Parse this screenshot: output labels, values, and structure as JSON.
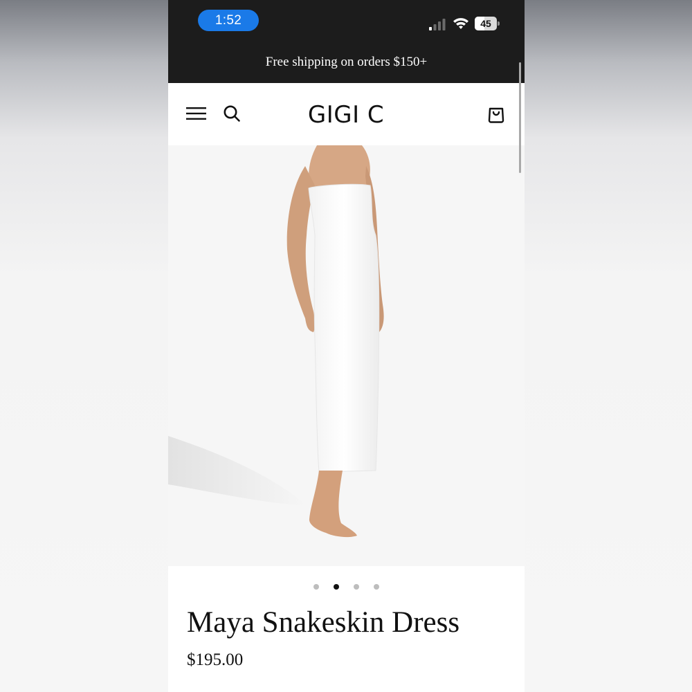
{
  "status_bar": {
    "time": "1:52",
    "battery_level": "45",
    "battery_fraction": 0.45,
    "signal_icon": "cellular-signal-icon",
    "wifi_icon": "wifi-icon"
  },
  "announcement": {
    "text": "Free shipping on orders $150+"
  },
  "header": {
    "logo": "GIGI C",
    "menu_icon": "hamburger-menu-icon",
    "search_icon": "search-icon",
    "cart_icon": "shopping-bag-icon"
  },
  "product": {
    "image_description_icon": "product-photo",
    "title": "Maya Snakeskin Dress",
    "price": "$195.00",
    "carousel": {
      "total": 4,
      "active_index": 1
    }
  },
  "colors": {
    "bar_background": "#1c1c1c",
    "time_pill": "#1a7ae8",
    "text": "#111111",
    "image_background": "#f6f6f6",
    "dot_inactive": "#bdbdbd",
    "dot_active": "#111111"
  }
}
